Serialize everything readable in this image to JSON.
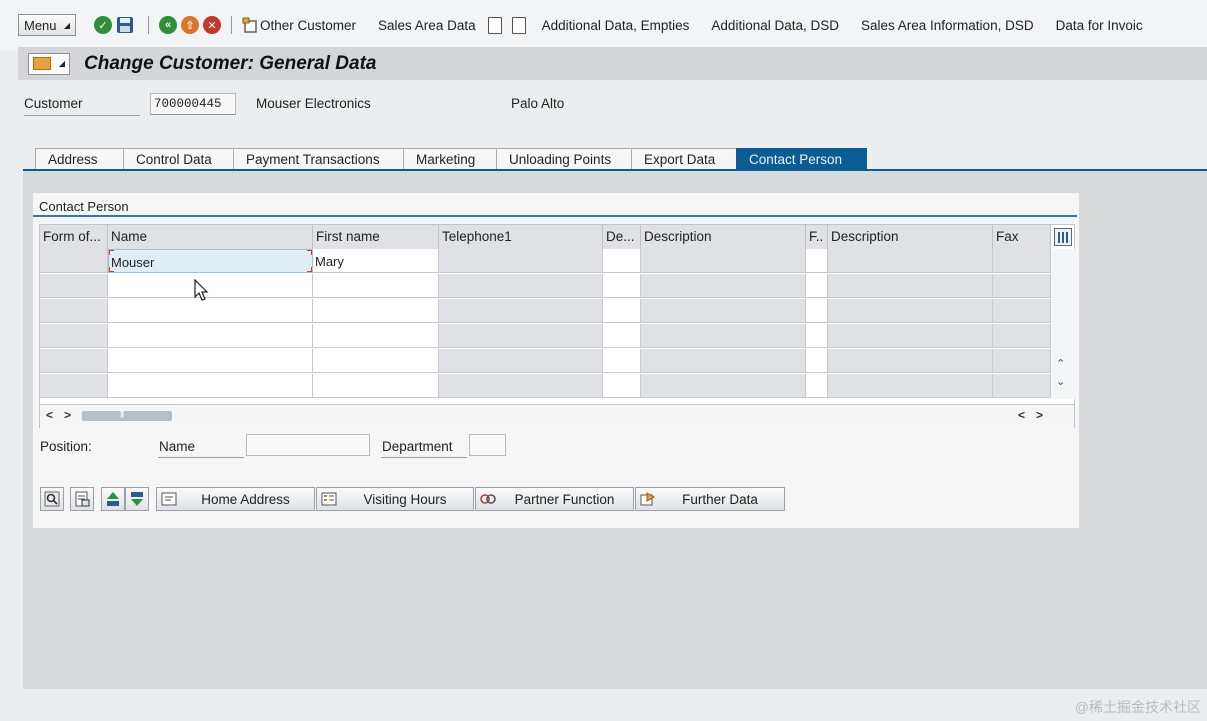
{
  "toolbar": {
    "menu_label": "Menu",
    "links": [
      "Other Customer",
      "Sales Area Data",
      "Additional Data, Empties",
      "Additional Data, DSD",
      "Sales Area Information, DSD",
      "Data for Invoic"
    ]
  },
  "title": "Change Customer: General Data",
  "customer": {
    "label": "Customer",
    "number": "700000445",
    "name": "Mouser Electronics",
    "city": "Palo Alto"
  },
  "tabs": [
    "Address",
    "Control Data",
    "Payment Transactions",
    "Marketing",
    "Unloading Points",
    "Export Data",
    "Contact Person"
  ],
  "active_tab": "Contact Person",
  "contact_panel": {
    "title": "Contact Person",
    "columns": [
      "Form of...",
      "Name",
      "First name",
      "Telephone1",
      "De...",
      "Description",
      "F..",
      "Description",
      "Fax"
    ],
    "rows": [
      [
        "",
        "Mouser",
        "Mary",
        "",
        "",
        "",
        "",
        "",
        ""
      ]
    ]
  },
  "position_row": {
    "position_label": "Position:",
    "name_label": "Name",
    "department_label": "Department"
  },
  "buttons": [
    "Home Address",
    "Visiting Hours",
    "Partner Function",
    "Further Data"
  ],
  "colors": {
    "active_tab": "#0a5c93",
    "accent_line": "#2d78b4",
    "ok_green": "#2f8f3a",
    "cancel_red": "#c0392b",
    "exit_orange": "#d9762b"
  },
  "watermark": "@稀土掘金技术社区"
}
